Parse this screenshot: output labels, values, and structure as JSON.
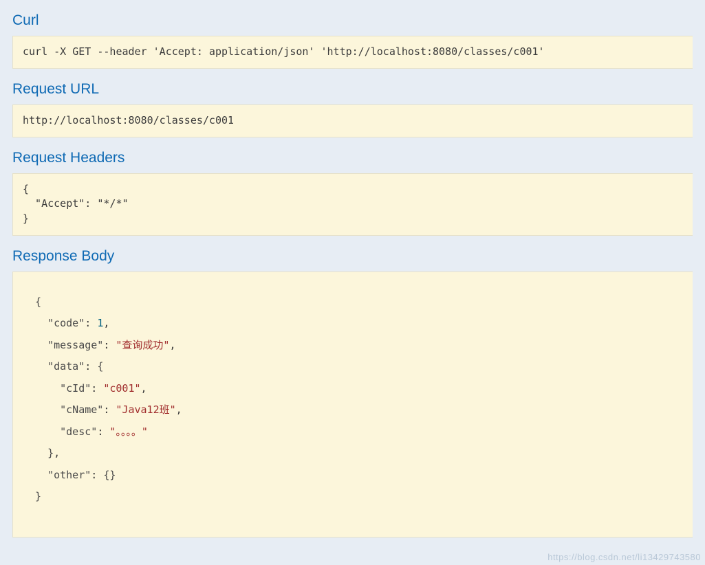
{
  "sections": {
    "curl": {
      "title": "Curl",
      "content": "curl -X GET --header 'Accept: application/json' 'http://localhost:8080/classes/c001'"
    },
    "request_url": {
      "title": "Request URL",
      "content": "http://localhost:8080/classes/c001"
    },
    "request_headers": {
      "title": "Request Headers",
      "content": "{\n  \"Accept\": \"*/*\"\n}"
    },
    "response_body": {
      "title": "Response Body",
      "json": {
        "code": 1,
        "message": "查询成功",
        "data": {
          "cId": "c001",
          "cName": "Java12班",
          "desc": "。。。。"
        },
        "other": {}
      }
    }
  },
  "watermark": "https://blog.csdn.net/li13429743580"
}
